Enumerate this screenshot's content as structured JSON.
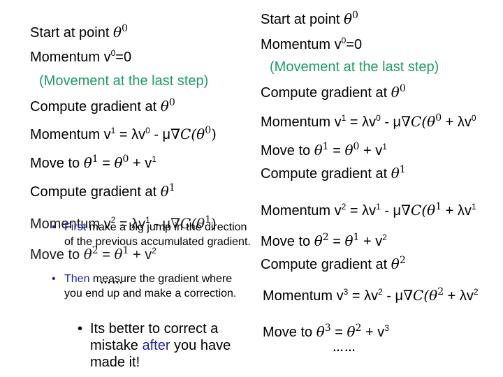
{
  "left_panel": {
    "start": {
      "text": "Start at point ",
      "theta": "θ",
      "sup": "0"
    },
    "momentum0": {
      "text": "Momentum v",
      "sup": "0",
      "rest": "=0"
    },
    "movement_note": "(Movement at the last step)",
    "compute0": {
      "text": "Compute gradient at ",
      "theta": "θ",
      "sup": "0"
    },
    "momentum1": {
      "prefix": "Momentum v",
      "sup1": "1",
      "mid": " = λv",
      "sup2": "0",
      "minus": " - μ",
      "grad": "∇C(θ",
      "sup3": "0",
      "close": ")"
    },
    "move1": {
      "prefix": "Move to ",
      "lhs": "θ",
      "lhs_sup": "1",
      "eq": " = ",
      "rhs": "θ",
      "rhs_sup": "0",
      "plus": " + v",
      "v_sup": "1"
    },
    "compute1": {
      "text": "Compute gradient at ",
      "theta": "θ",
      "sup": "1"
    },
    "momentum2": {
      "prefix": "Momentum v",
      "sup1": "2",
      "mid": " = λv",
      "sup2": "1",
      "minus": " - μ",
      "grad": "∇C(θ",
      "sup3": "1",
      "close": ")"
    },
    "move2": {
      "prefix": "Move to ",
      "lhs": "θ",
      "lhs_sup": "2",
      "eq": " = ",
      "rhs": "θ",
      "rhs_sup": "1",
      "plus": " + v",
      "v_sup": "2"
    },
    "ellipsis": "……",
    "bullets": [
      {
        "highlight": "First",
        "text": " make a big jump in the direction of the previous accumulated gradient."
      },
      {
        "highlight": "Then",
        "text": " measure the gradient where you end up and make a correction."
      }
    ],
    "sub_bullet": {
      "before": "Its better to correct a mistake ",
      "highlight": "after",
      "after": " you have made it!"
    }
  },
  "right_panel": {
    "start": {
      "text": "Start at point ",
      "theta": "θ",
      "sup": "0"
    },
    "momentum0": {
      "text": "Momentum v",
      "sup": "0",
      "rest": "=0"
    },
    "movement_note": "(Movement at the last step)",
    "compute0": {
      "text": "Compute gradient at ",
      "theta": "θ",
      "sup": "0"
    },
    "momentum1": {
      "prefix": "Momentum v",
      "sup1": "1",
      "mid": " = λv",
      "sup2": "0",
      "minus": " - μ",
      "grad": "∇C(θ",
      "sup3": "0",
      "tail": " + λv",
      "tail_sup": "0"
    },
    "move1": {
      "prefix": "Move to ",
      "lhs": "θ",
      "lhs_sup": "1",
      "eq": " = ",
      "rhs": "θ",
      "rhs_sup": "0",
      "plus": " + v",
      "v_sup": "1"
    },
    "compute1": {
      "text": "Compute gradient at ",
      "theta": "θ",
      "sup": "1"
    },
    "momentum2": {
      "prefix": "Momentum v",
      "sup1": "2",
      "mid": " = λv",
      "sup2": "1",
      "minus": " - μ",
      "grad": "∇C(θ",
      "sup3": "1",
      "tail": " + λv",
      "tail_sup": "1"
    },
    "move2": {
      "prefix": "Move to ",
      "lhs": "θ",
      "lhs_sup": "2",
      "eq": " = ",
      "rhs": "θ",
      "rhs_sup": "1",
      "plus": " + v",
      "v_sup": "2"
    },
    "compute2": {
      "text": "Compute gradient at ",
      "theta": "θ",
      "sup": "2"
    },
    "momentum3": {
      "prefix": "Momentum v",
      "sup1": "3",
      "mid": " = λv",
      "sup2": "2",
      "minus": " - μ",
      "grad": "∇C(θ",
      "sup3": "2",
      "tail": " + λv",
      "tail_sup": "2"
    },
    "move3": {
      "prefix": "Move to ",
      "lhs": "θ",
      "lhs_sup": "3",
      "eq": " = ",
      "rhs": "θ",
      "rhs_sup": "2",
      "plus": " + v",
      "v_sup": "3"
    },
    "ellipsis": "……"
  },
  "colors": {
    "note_green": "#1e9c63",
    "highlight_blue": "#1f24a0",
    "text": "#000000"
  }
}
